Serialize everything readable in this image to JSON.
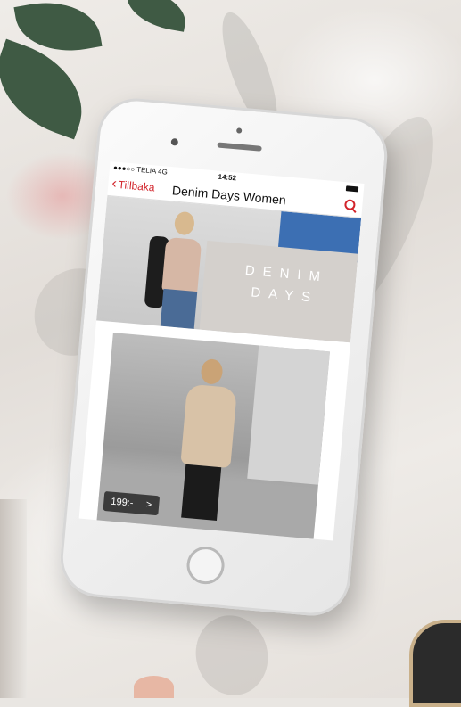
{
  "statusbar": {
    "carrier": "●●●○○ TELIA 4G",
    "time": "14:52"
  },
  "navbar": {
    "back_label": "Tillbaka",
    "title": "Denim Days Women",
    "back_icon": "chevron-left-icon",
    "search_icon": "search-icon"
  },
  "banner": {
    "text": "DENIM DAYS"
  },
  "product": {
    "price": "199:-",
    "arrow": ">"
  },
  "colors": {
    "accent": "#d2232a"
  }
}
